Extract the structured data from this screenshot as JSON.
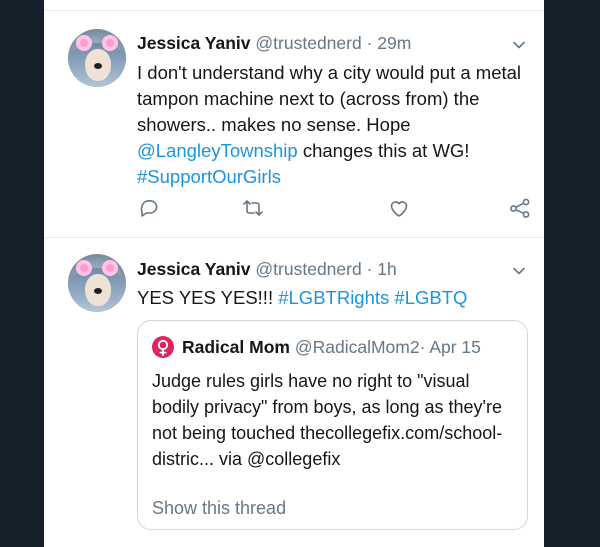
{
  "tweets": [
    {
      "name": "Jessica Yaniv",
      "handle": "@trustednerd",
      "separator": "·",
      "time": "29m",
      "text_parts": {
        "p1": "I don't understand why a city would put a metal tampon machine next to (across from) the showers.. makes no sense. Hope ",
        "mention": "@LangleyTownship",
        "p2": " changes this at WG!",
        "hashtag": "#SupportOurGirls"
      }
    },
    {
      "name": "Jessica Yaniv",
      "handle": "@trustednerd",
      "separator": "·",
      "time": "1h",
      "text_parts": {
        "p1": "YES YES YES!!! ",
        "hashtag1": "#LGBTRights",
        "space": " ",
        "hashtag2": "#LGBTQ"
      },
      "quote": {
        "name": "Radical Mom",
        "handle": "@RadicalMom2",
        "separator": "·",
        "time": "Apr 15",
        "text": "Judge rules girls have no right to \"visual bodily privacy\" from boys, as long as they're not being touched thecollegefix.com/school-distric... via @collegefix",
        "show_thread": "Show this thread"
      }
    }
  ],
  "icons": {
    "reply": "reply-icon",
    "retweet": "retweet-icon",
    "like": "heart-icon",
    "share": "share-icon",
    "caret": "chevron-down-icon",
    "female_symbol": "female-symbol-icon"
  },
  "colors": {
    "background": "#15202b",
    "text": "#14171a",
    "secondary": "#657786",
    "link": "#1b95e0",
    "quote_avatar": "#e0245e"
  }
}
